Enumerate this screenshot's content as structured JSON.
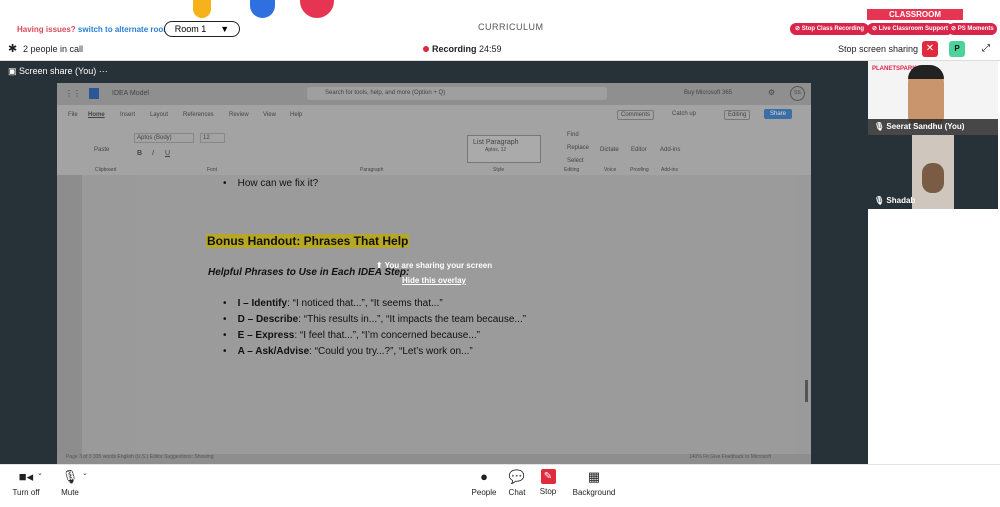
{
  "banner": {
    "issue_text": "Having issues?",
    "issue_link": "switch to alternate room",
    "room": "Room 1",
    "room_caret": "▼",
    "curriculum": "CURRICULUM",
    "classroom": "CLASSROOM",
    "pills": [
      "Stop Class Recording",
      "Live Classroom Support",
      "PS Moments"
    ]
  },
  "call": {
    "people": "2 people in call",
    "recording_label": "Recording",
    "recording_time": "24:59",
    "stop_sharing": "Stop screen sharing",
    "participant_badge": "P"
  },
  "share": {
    "label": "Screen share (You)",
    "more": "···"
  },
  "word": {
    "app_name": "IDEA Model",
    "search_placeholder": "Search for tools, help, and more (Option + Q)",
    "buy": "Buy Microsoft 365",
    "avatar": "SS",
    "tabs": [
      "File",
      "Home",
      "Insert",
      "Layout",
      "References",
      "Review",
      "View",
      "Help"
    ],
    "comments": "Comments",
    "catch_up": "Catch up",
    "editing": "Editing",
    "share_btn": "Share",
    "font": "Aptos (Body)",
    "font_size": "12",
    "style_name": "List Paragraph",
    "style_font": "Aptos, 12",
    "groups": [
      "Clipboard",
      "Font",
      "Paragraph",
      "Style",
      "Editing",
      "Voice",
      "Proofing",
      "Add-ins"
    ],
    "paste": "Paste",
    "find": "Find",
    "replace": "Replace",
    "select": "Select",
    "dictate": "Dictate",
    "editor": "Editor",
    "addins": "Add-ins",
    "status_left": "Page 3 of 3   335 words   English (U.S.)   Editor Suggestions: Showing",
    "status_right": "140%   Fit   Give Feedback to Microsoft"
  },
  "document": {
    "bullet_top": "How can we fix it?",
    "heading": "Bonus Handout: Phrases That Help",
    "subheading": "Helpful Phrases to Use in Each IDEA Step:",
    "items": [
      {
        "term": "I – Identify",
        "text": ": “I noticed that...”, “It seems that...”"
      },
      {
        "term": "D – Describe",
        "text": ": “This results in...”, “It impacts the team because...”"
      },
      {
        "term": "E – Express",
        "text": ": “I feel that...”, “I’m concerned because...”"
      },
      {
        "term": "A – Ask/Advise",
        "text": ": “Could you try...?”, “Let’s work on...”"
      }
    ]
  },
  "overlay": {
    "sharing": "You are sharing your screen",
    "hide": "Hide this overlay"
  },
  "participants": [
    {
      "name": "Seerat Sandhu (You)",
      "watermark": "PLANETSPARK"
    },
    {
      "name": "Shadab"
    }
  ],
  "controls": {
    "turn_off": "Turn off",
    "mute": "Mute",
    "people": "People",
    "chat": "Chat",
    "stop": "Stop",
    "background": "Background"
  },
  "colors": {
    "accent_red": "#e02b3e",
    "participant_green": "#4cd29a",
    "link_blue": "#2a7fd4",
    "highlight": "#b6a826"
  }
}
